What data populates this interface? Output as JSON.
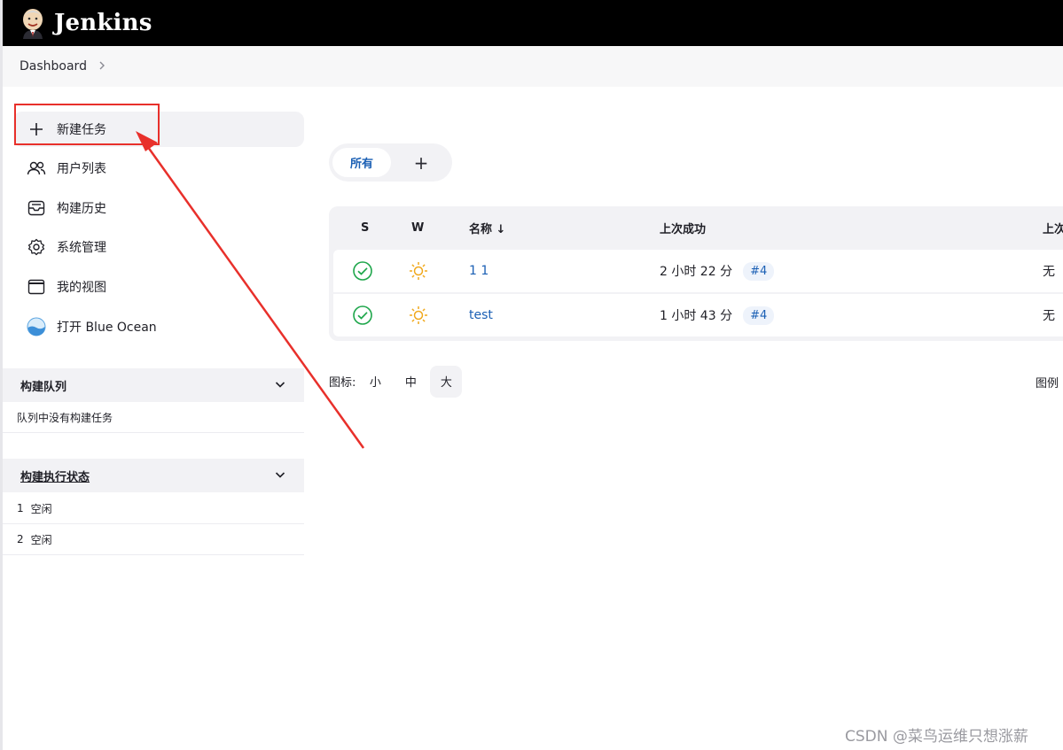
{
  "header": {
    "brand": "Jenkins"
  },
  "breadcrumb": {
    "items": [
      "Dashboard"
    ]
  },
  "sidebar": {
    "tasks": [
      {
        "label": "新建任务",
        "icon": "plus-icon"
      },
      {
        "label": "用户列表",
        "icon": "people-icon"
      },
      {
        "label": "构建历史",
        "icon": "inbox-icon"
      },
      {
        "label": "系统管理",
        "icon": "gear-icon"
      },
      {
        "label": "我的视图",
        "icon": "window-icon"
      },
      {
        "label": "打开 Blue Ocean",
        "icon": "blue-ocean-icon"
      }
    ],
    "build_queue": {
      "title": "构建队列",
      "empty_text": "队列中没有构建任务"
    },
    "executors": {
      "title": "构建执行状态",
      "rows": [
        {
          "num": "1",
          "status": "空闲"
        },
        {
          "num": "2",
          "status": "空闲"
        }
      ]
    }
  },
  "views": {
    "tabs": [
      "所有"
    ],
    "add": "+"
  },
  "jobs_table": {
    "headers": {
      "s": "S",
      "w": "W",
      "name": "名称 ↓",
      "last_success": "上次成功",
      "last_failure": "上次"
    },
    "rows": [
      {
        "name": "1 1",
        "last_success": "2 小时 22 分",
        "build": "#4",
        "last_failure": "无"
      },
      {
        "name": "test",
        "last_success": "1 小时 43 分",
        "build": "#4",
        "last_failure": "无"
      }
    ]
  },
  "icon_size": {
    "label": "图标:",
    "options": [
      "小",
      "中",
      "大"
    ],
    "selected": "大"
  },
  "legend_label": "图例",
  "watermark": "CSDN @菜鸟运维只想涨薪",
  "colors": {
    "success": "#1ea64b",
    "weather": "#f0a81c",
    "link": "#1a5fb4",
    "annotation": "#e8302b"
  }
}
